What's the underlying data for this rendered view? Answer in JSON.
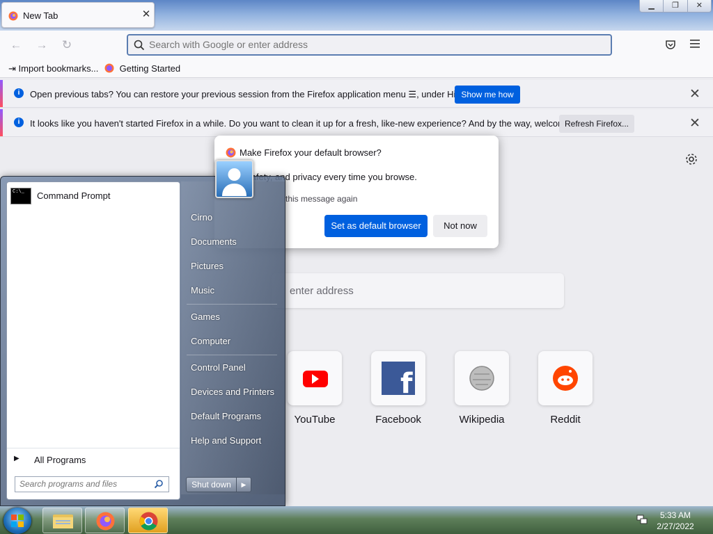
{
  "browser": {
    "tab": {
      "title": "New Tab",
      "close": "✕"
    },
    "window_controls": {
      "minimize": "▁",
      "restore": "❐",
      "close": "✕"
    },
    "urlbar": {
      "placeholder": "Search with Google or enter address",
      "value": ""
    },
    "nav": {
      "back": "←",
      "forward": "→",
      "reload": "↻"
    },
    "bookmarks": [
      {
        "label": "Import bookmarks...",
        "icon": "import-icon"
      },
      {
        "label": "Getting Started",
        "icon": "firefox-icon"
      }
    ]
  },
  "notifications": [
    {
      "message": "Open previous tabs? You can restore your previous session from the Firefox application menu ☰, under History.",
      "button": "Show me how",
      "close": "✕"
    },
    {
      "message": "It looks like you haven't started Firefox in a while. Do you want to clean it up for a fresh, like-new experience? And by the way, welcome back!",
      "button": "Refresh Firefox...",
      "close": "✕"
    }
  ],
  "newtab": {
    "search_placeholder": "enter address",
    "top_sites": [
      {
        "label": "YouTube",
        "color": "#ff0000"
      },
      {
        "label": "Facebook",
        "color": "#1877f2"
      },
      {
        "label": "Wikipedia",
        "color": "#9a9a9a"
      },
      {
        "label": "Reddit",
        "color": "#ff4500"
      }
    ]
  },
  "default_dialog": {
    "title": "Make Firefox your default browser?",
    "subtitle": "l, safety, and privacy every time you browse.",
    "checkbox_label": "this message again",
    "primary": "Set as default browser",
    "secondary": "Not now"
  },
  "start_menu": {
    "pinned": [
      {
        "label": "Command Prompt",
        "icon": "command-prompt-icon"
      }
    ],
    "all_programs": "All Programs",
    "search_placeholder": "Search programs and files",
    "right_items": [
      "Cirno",
      "Documents",
      "Pictures",
      "Music",
      "Games",
      "Computer",
      "Control Panel",
      "Devices and Printers",
      "Default Programs",
      "Help and Support"
    ],
    "shutdown": "Shut down",
    "shutdown_arrow": "▶"
  },
  "taskbar": {
    "items": [
      "windows-explorer-icon",
      "firefox-icon",
      "chrome-icon"
    ],
    "time": "5:33 AM",
    "date": "2/27/2022"
  }
}
